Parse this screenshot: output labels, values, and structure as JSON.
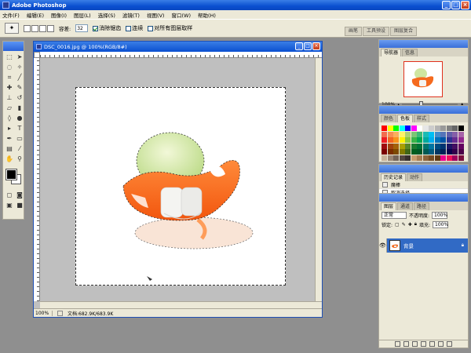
{
  "app": {
    "title": "Adobe Photoshop"
  },
  "menu": [
    "文件(F)",
    "编辑(E)",
    "图像(I)",
    "图层(L)",
    "选择(S)",
    "滤镜(T)",
    "视图(V)",
    "窗口(W)",
    "帮助(H)"
  ],
  "options": {
    "feather_label": "容差:",
    "feather_value": "32",
    "antialias_label": "消除锯齿",
    "contiguous_label": "连续",
    "sample_all_label": "对所有图层取样"
  },
  "palette_well": [
    "画笔",
    "工具预设",
    "图层复合"
  ],
  "document": {
    "title": "DSC_0016.jpg @ 100%(RGB/8#)",
    "zoom": "100%",
    "doc_size": "文档:682.9K/683.9K"
  },
  "panels": {
    "navigator_tabs": [
      "导航器",
      "信息"
    ],
    "navigator_zoom": "100%",
    "color_tabs": [
      "颜色",
      "色板",
      "样式"
    ],
    "history_tabs": [
      "历史记录",
      "动作"
    ],
    "history_items": [
      "魔棒",
      "取消选择"
    ],
    "layers_tabs": [
      "图层",
      "通道",
      "路径"
    ],
    "blend_mode": "正常",
    "opacity_label": "不透明度:",
    "opacity_value": "100%",
    "lock_label": "锁定:",
    "fill_label": "填充:",
    "fill_value": "100%",
    "layer_name": "背景"
  },
  "swatch_colors": [
    "#ff0000",
    "#ffff00",
    "#00ff00",
    "#00ffff",
    "#0000ff",
    "#ff00ff",
    "#ffffff",
    "#e6e6e6",
    "#cccccc",
    "#b3b3b3",
    "#999999",
    "#808080",
    "#666666",
    "#000000",
    "#f26c4f",
    "#f68e55",
    "#fbaf5c",
    "#fff467",
    "#acd372",
    "#7cc576",
    "#3bb878",
    "#1abbb4",
    "#00bff3",
    "#438ccb",
    "#5574b9",
    "#605ca8",
    "#855fa8",
    "#a763a8",
    "#ed1c24",
    "#f26522",
    "#f7941d",
    "#fff200",
    "#8dc63f",
    "#39b54a",
    "#00a651",
    "#00a99d",
    "#00aeef",
    "#0072bc",
    "#0054a6",
    "#2e3192",
    "#662d91",
    "#92278f",
    "#9e0b0f",
    "#a0410d",
    "#a36209",
    "#aba000",
    "#598527",
    "#1a7b30",
    "#007236",
    "#00746b",
    "#0076a3",
    "#004b80",
    "#003471",
    "#1b1464",
    "#440e62",
    "#630460",
    "#790000",
    "#7b2e00",
    "#7d4900",
    "#827b00",
    "#406618",
    "#005e20",
    "#005826",
    "#005952",
    "#005b7f",
    "#003663",
    "#002157",
    "#0d004c",
    "#32004b",
    "#4b0049",
    "#c7b299",
    "#998675",
    "#736357",
    "#534741",
    "#37302d",
    "#c69c6d",
    "#a67c52",
    "#8c6239",
    "#754c24",
    "#603913",
    "#ec008c",
    "#ed145b",
    "#9e005d",
    "#790e3e"
  ]
}
